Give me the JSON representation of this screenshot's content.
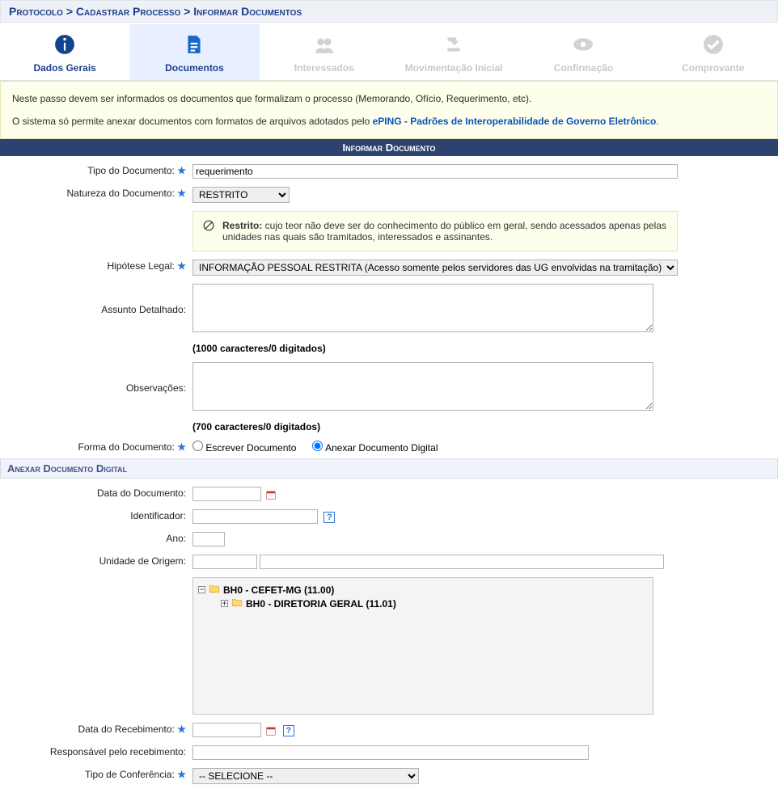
{
  "breadcrumb": "Protocolo > Cadastrar Processo > Informar Documentos",
  "tabs": [
    {
      "label": "Dados Gerais"
    },
    {
      "label": "Documentos"
    },
    {
      "label": "Interessados"
    },
    {
      "label": "Movimentação Inicial"
    },
    {
      "label": "Confirmação"
    },
    {
      "label": "Comprovante"
    }
  ],
  "intro": {
    "line1": "Neste passo devem ser informados os documentos que formalizam o processo (Memorando, Ofício, Requerimento, etc).",
    "line2_prefix": "O sistema só permite anexar documentos com formatos de arquivos adotados pelo ",
    "line2_link": "ePING - Padrões de Interoperabilidade de Governo Eletrônico",
    "line2_suffix": "."
  },
  "sections": {
    "informar": "Informar Documento",
    "anexar": "Anexar Documento Digital"
  },
  "form": {
    "tipo_documento_label": "Tipo do Documento:",
    "tipo_documento_value": "requerimento",
    "natureza_label": "Natureza do Documento:",
    "natureza_value": "RESTRITO",
    "restrito_bold": "Restrito:",
    "restrito_text": " cujo teor não deve ser do conhecimento do público em geral, sendo acessados apenas pelas unidades nas quais são tramitados, interessados e assinantes.",
    "hipotese_label": "Hipótese Legal:",
    "hipotese_value": "INFORMAÇÃO PESSOAL RESTRITA (Acesso somente pelos servidores das UG envolvidas na tramitação)",
    "assunto_label": "Assunto Detalhado:",
    "assunto_counter": "(1000 caracteres/0 digitados)",
    "obs_label": "Observações:",
    "obs_counter": "(700 caracteres/0 digitados)",
    "forma_label": "Forma do Documento:",
    "forma_opt1": "Escrever Documento",
    "forma_opt2": "Anexar Documento Digital",
    "data_doc_label": "Data do Documento:",
    "identificador_label": "Identificador:",
    "ano_label": "Ano:",
    "unidade_origem_label": "Unidade de Origem:",
    "tree_node1": "BH0 - CEFET-MG (11.00)",
    "tree_node2": "BH0 - DIRETORIA GERAL (11.01)",
    "data_receb_label": "Data do Recebimento:",
    "responsavel_label": "Responsável pelo recebimento:",
    "tipo_conf_label": "Tipo de Conferência:",
    "tipo_conf_value": "-- SELECIONE --"
  }
}
